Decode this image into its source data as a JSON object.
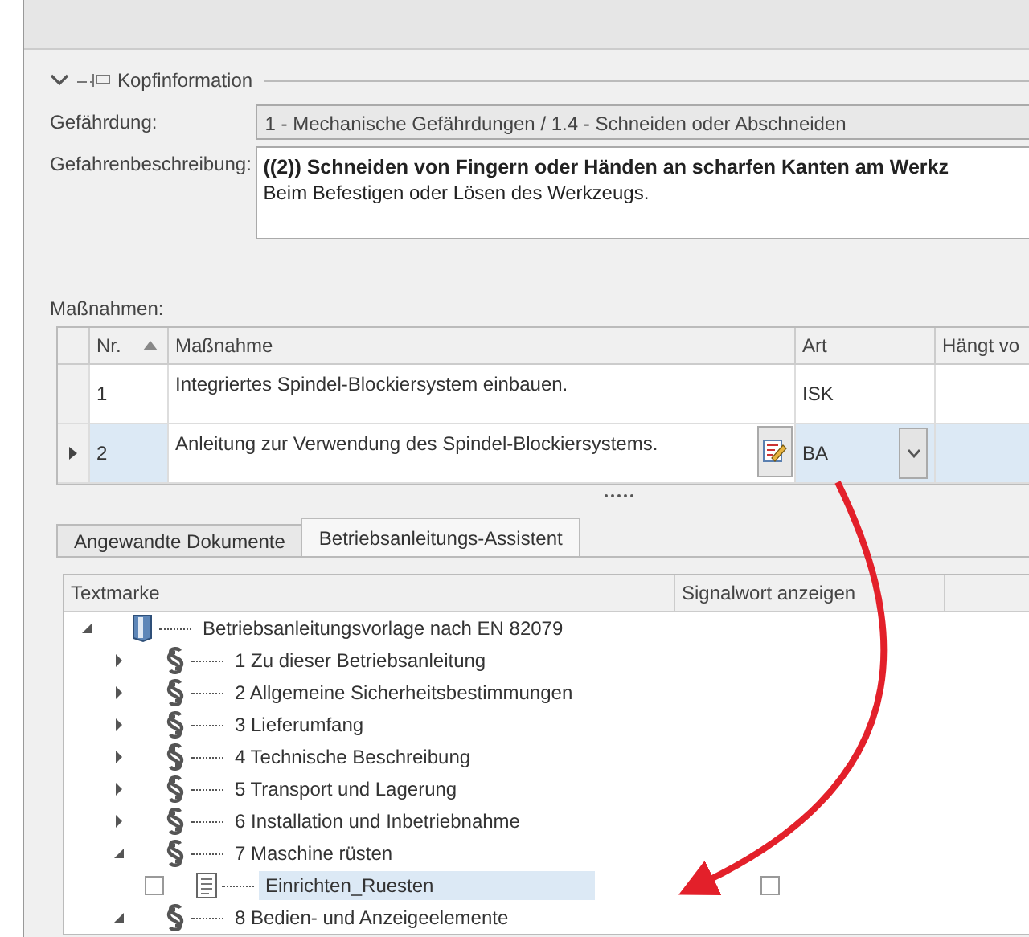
{
  "header_group": {
    "title": "Kopfinformation",
    "expanded": true
  },
  "fields": [
    {
      "label": "Gefährdung:",
      "kind": "combo",
      "value": "1 - Mechanische Gefährdungen / 1.4 - Schneiden oder Abschneiden"
    },
    {
      "label": "Gefahrenbeschreibung:",
      "kind": "memo",
      "title": "((2)) Schneiden von Fingern oder Händen an scharfen Kanten am Werkz",
      "value": "Beim Befestigen oder Lösen des Werkzeugs."
    }
  ],
  "measures": {
    "label": "Maßnahmen:",
    "columns": [
      "Nr.",
      "Maßnahme",
      "Art",
      "Hängt vo"
    ],
    "rows": [
      {
        "nr": "1",
        "text": "Integriertes Spindel-Blockiersystem einbauen.",
        "art": "ISK",
        "selected": false
      },
      {
        "nr": "2",
        "text": "Anleitung zur Verwendung des Spindel-Blockiersystems.",
        "art": "BA",
        "selected": true
      }
    ]
  },
  "tabs": [
    {
      "label": "Angewandte Dokumente",
      "selected": false
    },
    {
      "label": "Betriebsanleitungs-Assistent",
      "selected": true
    }
  ],
  "tree": {
    "columns": [
      "Textmarke",
      "Signalwort anzeigen"
    ],
    "nodes": [
      {
        "label": "Betriebsanleitungsvorlage nach EN 82079",
        "kind": "book",
        "expanded": true,
        "children": [
          {
            "label": "1 Zu dieser Betriebsanleitung",
            "kind": "section",
            "expanded": false
          },
          {
            "label": "2 Allgemeine Sicherheitsbestimmungen",
            "kind": "section",
            "expanded": false
          },
          {
            "label": "3 Lieferumfang",
            "kind": "section",
            "expanded": false
          },
          {
            "label": "4 Technische Beschreibung",
            "kind": "section",
            "expanded": false
          },
          {
            "label": "5 Transport und Lagerung",
            "kind": "section",
            "expanded": false
          },
          {
            "label": "6 Installation und Inbetriebnahme",
            "kind": "section",
            "expanded": false
          },
          {
            "label": "7 Maschine rüsten",
            "kind": "section",
            "expanded": true,
            "children": [
              {
                "label": "Einrichten_Ruesten",
                "kind": "document",
                "checked": false,
                "signal": false,
                "selected": true
              }
            ]
          },
          {
            "label": "8 Bedien- und Anzeigeelemente",
            "kind": "section",
            "expanded": true
          }
        ]
      }
    ]
  }
}
